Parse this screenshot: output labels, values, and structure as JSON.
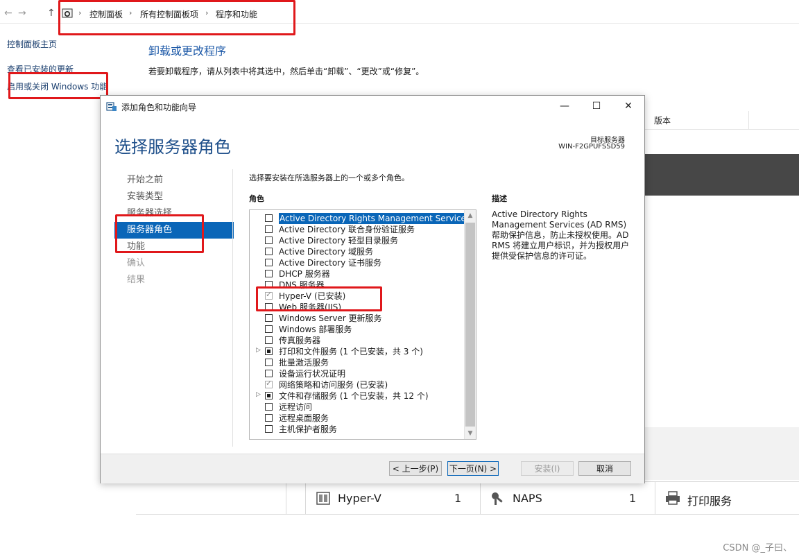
{
  "explorer": {
    "nav": {
      "back": "←",
      "forward": "→",
      "up": "↑"
    },
    "breadcrumb": [
      "控制面板",
      "所有控制面板项",
      "程序和功能"
    ],
    "breadcrumb_separator": "›",
    "left_links": [
      "控制面板主页",
      "查看已安装的更新",
      "启用或关闭 Windows 功能"
    ],
    "title": "卸载或更改程序",
    "subtitle": "若要卸载程序，请从列表中将其选中，然后单击“卸载”、“更改”或“修复”。",
    "column_version": "版本"
  },
  "dialog": {
    "window_title": "添加角色和功能向导",
    "controls": {
      "minimize": "—",
      "maximize": "☐",
      "close": "✕"
    },
    "heading": "选择服务器角色",
    "target_server_label": "目标服务器",
    "target_server_name": "WIN-F2GPUFSSD59",
    "steps": [
      {
        "label": "开始之前",
        "state": "done"
      },
      {
        "label": "安装类型",
        "state": "done"
      },
      {
        "label": "服务器选择",
        "state": "done"
      },
      {
        "label": "服务器角色",
        "state": "active"
      },
      {
        "label": "功能",
        "state": "done"
      },
      {
        "label": "确认",
        "state": "future"
      },
      {
        "label": "结果",
        "state": "future"
      }
    ],
    "instruction": "选择要安装在所选服务器上的一个或多个角色。",
    "roles_header": "角色",
    "description_header": "描述",
    "description": "Active Directory Rights Management Services (AD RMS) 帮助保护信息，防止未授权使用。AD RMS 将建立用户标识，并为授权用户提供受保护信息的许可证。",
    "roles": [
      {
        "label": "Active Directory Rights Management Services",
        "state": "unchecked",
        "selected": true,
        "expandable": false
      },
      {
        "label": "Active Directory 联合身份验证服务",
        "state": "unchecked",
        "selected": false,
        "expandable": false
      },
      {
        "label": "Active Directory 轻型目录服务",
        "state": "unchecked",
        "selected": false,
        "expandable": false
      },
      {
        "label": "Active Directory 域服务",
        "state": "unchecked",
        "selected": false,
        "expandable": false
      },
      {
        "label": "Active Directory 证书服务",
        "state": "unchecked",
        "selected": false,
        "expandable": false
      },
      {
        "label": "DHCP 服务器",
        "state": "unchecked",
        "selected": false,
        "expandable": false
      },
      {
        "label": "DNS 服务器",
        "state": "unchecked",
        "selected": false,
        "expandable": false
      },
      {
        "label": "Hyper-V (已安装)",
        "state": "checked",
        "selected": false,
        "expandable": false
      },
      {
        "label": "Web 服务器(IIS)",
        "state": "unchecked",
        "selected": false,
        "expandable": false
      },
      {
        "label": "Windows Server 更新服务",
        "state": "unchecked",
        "selected": false,
        "expandable": false
      },
      {
        "label": "Windows 部署服务",
        "state": "unchecked",
        "selected": false,
        "expandable": false
      },
      {
        "label": "传真服务器",
        "state": "unchecked",
        "selected": false,
        "expandable": false
      },
      {
        "label": "打印和文件服务 (1 个已安装，共 3 个)",
        "state": "partial",
        "selected": false,
        "expandable": true
      },
      {
        "label": "批量激活服务",
        "state": "unchecked",
        "selected": false,
        "expandable": false
      },
      {
        "label": "设备运行状况证明",
        "state": "unchecked",
        "selected": false,
        "expandable": false
      },
      {
        "label": "网络策略和访问服务 (已安装)",
        "state": "checked",
        "selected": false,
        "expandable": false
      },
      {
        "label": "文件和存储服务 (1 个已安装，共 12 个)",
        "state": "partial",
        "selected": false,
        "expandable": true
      },
      {
        "label": "远程访问",
        "state": "unchecked",
        "selected": false,
        "expandable": false
      },
      {
        "label": "远程桌面服务",
        "state": "unchecked",
        "selected": false,
        "expandable": false
      },
      {
        "label": "主机保护者服务",
        "state": "unchecked",
        "selected": false,
        "expandable": false
      }
    ],
    "buttons": {
      "previous": "< 上一步(P)",
      "next": "下一页(N) >",
      "install": "安装(I)",
      "cancel": "取消"
    }
  },
  "tiles": [
    {
      "name": "Hyper-V",
      "count": "1",
      "icon": "hyper-v-icon"
    },
    {
      "name": "NAPS",
      "count": "1",
      "icon": "naps-icon"
    },
    {
      "name": "打印服务",
      "count": "",
      "icon": "printer-icon"
    }
  ],
  "watermark": "CSDN @_子曰、",
  "colors": {
    "accent": "#0a66b8",
    "annotation_red": "#e0181b",
    "heading": "#1e4f8a"
  }
}
